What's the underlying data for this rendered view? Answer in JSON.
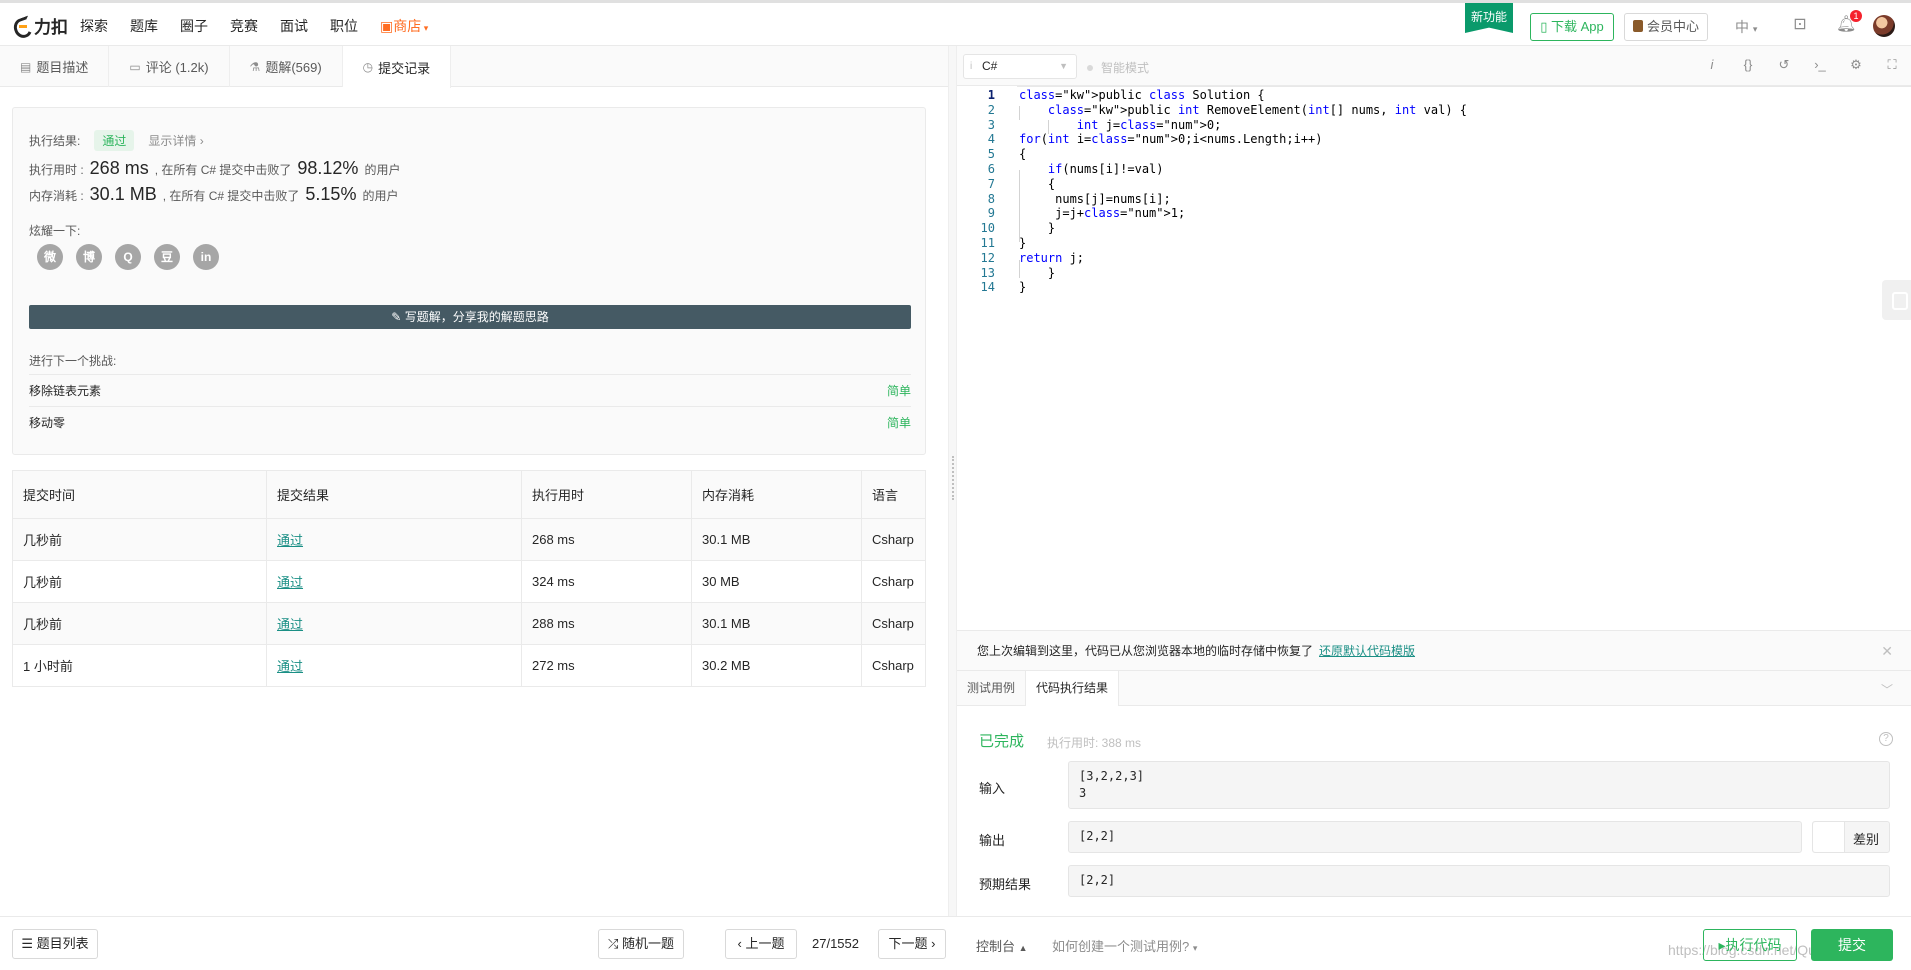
{
  "nav": {
    "logo": "力扣",
    "links": [
      "探索",
      "题库",
      "圈子",
      "竞赛",
      "面试",
      "职位"
    ],
    "shop": "商店",
    "new_feature": "新功能",
    "download_app": "下载 App",
    "member_center": "会员中心",
    "language": "中",
    "notification_count": "1"
  },
  "left_tabs": [
    {
      "label": "题目描述",
      "icon": "doc-icon"
    },
    {
      "label": "评论 (1.2k)",
      "icon": "comment-icon"
    },
    {
      "label": "题解(569)",
      "icon": "flask-icon"
    },
    {
      "label": "提交记录",
      "icon": "clock-icon"
    }
  ],
  "result": {
    "status_label": "执行结果:",
    "status": "通过",
    "show_details": "显示详情",
    "runtime_label": "执行用时 :",
    "runtime": "268 ms",
    "runtime_beat_text": ", 在所有 C# 提交中击败了",
    "runtime_percent": "98.12%",
    "runtime_suffix": "的用户",
    "memory_label": "内存消耗 :",
    "memory": "30.1 MB",
    "memory_beat_text": ", 在所有 C# 提交中击败了",
    "memory_percent": "5.15%",
    "memory_suffix": "的用户",
    "share_label": "炫耀一下:",
    "share_icons": [
      "wechat-icon",
      "weibo-icon",
      "qq-icon",
      "douban-icon",
      "linkedin-icon"
    ],
    "share_glyphs": [
      "微",
      "博",
      "Q",
      "豆",
      "in"
    ],
    "write_solution": "写题解，分享我的解题思路",
    "next_challenge": "进行下一个挑战:",
    "challenges": [
      {
        "name": "移除链表元素",
        "difficulty": "简单"
      },
      {
        "name": "移动零",
        "difficulty": "简单"
      }
    ]
  },
  "submissions": {
    "headers": [
      "提交时间",
      "提交结果",
      "执行用时",
      "内存消耗",
      "语言"
    ],
    "rows": [
      {
        "time": "几秒前",
        "result": "通过",
        "runtime": "268 ms",
        "memory": "30.1 MB",
        "lang": "Csharp"
      },
      {
        "time": "几秒前",
        "result": "通过",
        "runtime": "324 ms",
        "memory": "30 MB",
        "lang": "Csharp"
      },
      {
        "time": "几秒前",
        "result": "通过",
        "runtime": "288 ms",
        "memory": "30.1 MB",
        "lang": "Csharp"
      },
      {
        "time": "1 小时前",
        "result": "通过",
        "runtime": "272 ms",
        "memory": "30.2 MB",
        "lang": "Csharp"
      }
    ]
  },
  "editor": {
    "language": "C#",
    "smart_mode": "智能模式",
    "toolbar_icons": [
      "info-icon",
      "braces-icon",
      "reset-icon",
      "terminal-icon",
      "settings-icon",
      "fullscreen-icon"
    ],
    "code_lines": [
      "public class Solution {",
      "    public int RemoveElement(int[] nums, int val) {",
      "        int j=0;",
      "for(int i=0;i<nums.Length;i++)",
      "{",
      "    if(nums[i]!=val)",
      "    {",
      "     nums[j]=nums[i];",
      "     j=j+1;",
      "    }",
      "}",
      "return j;",
      "    }",
      "}"
    ]
  },
  "restore_banner": {
    "text": "您上次编辑到这里，代码已从您浏览器本地的临时存储中恢复了",
    "link": "还原默认代码模版"
  },
  "console": {
    "tabs": [
      "测试用例",
      "代码执行结果"
    ],
    "status": "已完成",
    "exec_time": "执行用时: 388 ms",
    "input_label": "输入",
    "input_value": "[3,2,2,3]\n3",
    "output_label": "输出",
    "output_value": "[2,2]",
    "diff_label": "差别",
    "expected_label": "预期结果",
    "expected_value": "[2,2]"
  },
  "bottom": {
    "problem_list": "题目列表",
    "random": "随机一题",
    "prev": "上一题",
    "page": "27/1552",
    "next": "下一题",
    "console": "控制台",
    "how_to_test": "如何创建一个测试用例?",
    "run_code": "执行代码",
    "submit": "提交",
    "watermark": "https://blog.csdn.net/Qunderrmen"
  },
  "colors": {
    "accent_green": "#2db55d",
    "link_teal": "#1a8f85",
    "shop_orange": "#ff6d22",
    "write_button": "#455a64"
  }
}
